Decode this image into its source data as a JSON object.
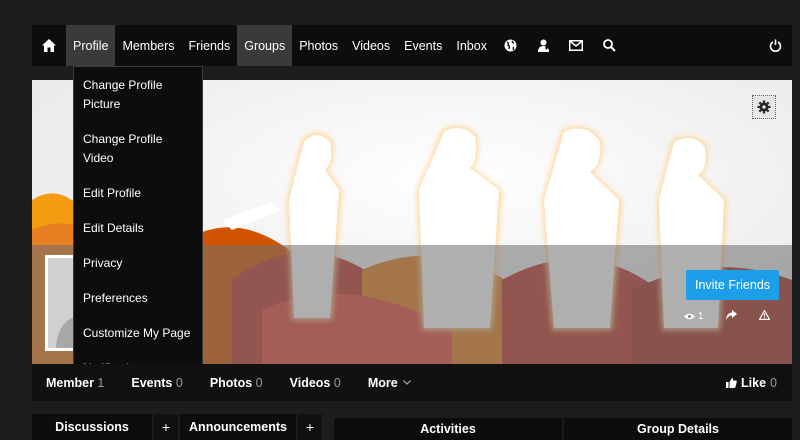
{
  "nav": {
    "items": [
      "Profile",
      "Members",
      "Friends",
      "Groups",
      "Photos",
      "Videos",
      "Events",
      "Inbox"
    ],
    "icons": [
      "home-icon",
      "globe-icon",
      "friend-request-icon",
      "mail-icon",
      "search-icon",
      "power-icon"
    ]
  },
  "dropdown": {
    "items": [
      "Change Profile Picture",
      "Change Profile Video",
      "Edit Profile",
      "Edit Details",
      "Privacy",
      "Preferences",
      "Customize My Page",
      "Notifications"
    ]
  },
  "cover": {
    "invite_label": "Invite Friends",
    "views": "1"
  },
  "stats": {
    "member_label": "Member",
    "member_count": "1",
    "events_label": "Events",
    "events_count": "0",
    "photos_label": "Photos",
    "photos_count": "0",
    "videos_label": "Videos",
    "videos_count": "0",
    "more_label": "More",
    "like_label": "Like",
    "like_count": "0"
  },
  "tabs": {
    "discussions": "Discussions",
    "announcements": "Announcements",
    "activities": "Activities",
    "group_details": "Group Details"
  },
  "colors": {
    "accent": "#1c9fe8",
    "nav_bg": "#0d0d0d",
    "page_bg": "#1c1c1c"
  }
}
